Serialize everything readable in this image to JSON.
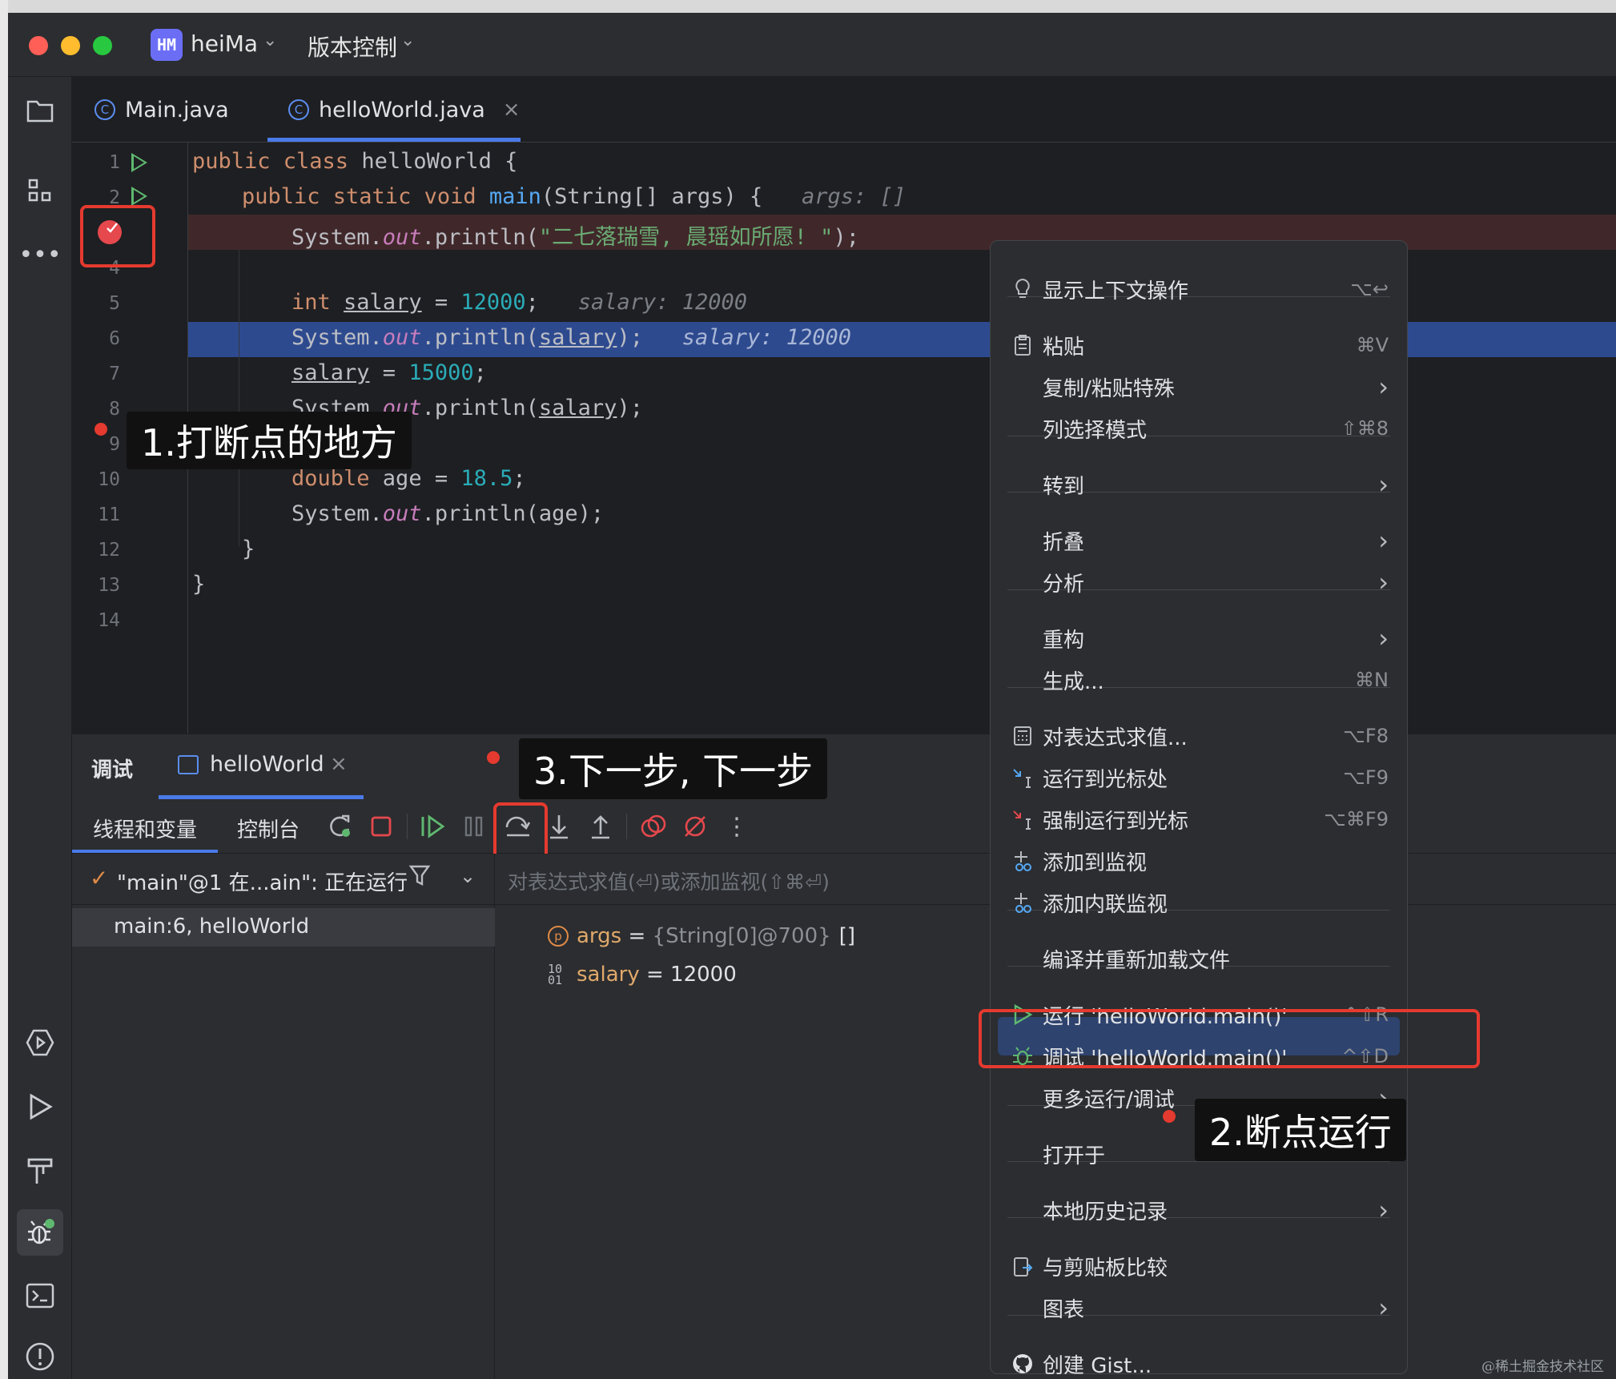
{
  "titlebar": {
    "project_badge": "HM",
    "project_name": "heiMa",
    "vcs_label": "版本控制"
  },
  "tabs": [
    {
      "label": "Main.java",
      "icon": "class-c-icon"
    },
    {
      "label": "helloWorld.java",
      "icon": "class-c-icon",
      "active": true,
      "close": "×"
    }
  ],
  "editor": {
    "line_numbers": [
      "1",
      "2",
      "3",
      "4",
      "5",
      "6",
      "7",
      "8",
      "9",
      "10",
      "11",
      "12",
      "13",
      "14"
    ],
    "lines": {
      "l1": {
        "kw": "public class",
        "rest": " helloWorld {"
      },
      "l2": {
        "kw": "public static void",
        "fn": "main",
        "rest": "(String[] args) {",
        "hint": "args: []"
      },
      "l3": {
        "pre": "System.",
        "field": "out",
        "mid": ".println(",
        "str": "\"二七落瑞雪, 晨瑶如所愿! \"",
        "post": ");"
      },
      "l5": {
        "kw": "int",
        "var": "salary",
        "eq": " = ",
        "num": "12000",
        "post": ";",
        "hint": "salary: 12000"
      },
      "l6": {
        "pre": "System.",
        "field": "out",
        "mid": ".println(",
        "var": "salary",
        "post": ");",
        "hint": "salary: 12000"
      },
      "l7": {
        "var": "salary",
        "eq": " = ",
        "num": "15000",
        "post": ";"
      },
      "l8": {
        "pre": "System.",
        "field": "out",
        "mid": ".println(",
        "var": "salary",
        "post": ");"
      },
      "l10": {
        "kw": "double",
        "rest": " age = ",
        "num": "18.5",
        "post": ";"
      },
      "l11": {
        "pre": "System.",
        "field": "out",
        "mid": ".println(age);"
      },
      "l12": "}",
      "l13": "}"
    }
  },
  "debug": {
    "title": "调试",
    "session_tab": "helloWorld",
    "session_close": "×",
    "threads_tab": "线程和变量",
    "console_tab": "控制台",
    "thread_status": "\"main\"@1 在...ain\": 正在运行",
    "frame": "main:6, helloWorld",
    "eval_placeholder": "对表达式求值(⏎)或添加监视(⇧⌘⏎)",
    "vars": [
      {
        "name": "args",
        "eq": " = ",
        "type": "{String[0]@700}",
        "value": "[]"
      },
      {
        "name": "salary",
        "eq": " = ",
        "value": "12000"
      }
    ],
    "more": "⋮"
  },
  "menu": {
    "items": [
      {
        "label": "显示上下文操作",
        "shortcut": "⌥↩",
        "icon": "bulb-icon"
      },
      {
        "label": "粘贴",
        "shortcut": "⌘V",
        "icon": "clipboard-icon"
      },
      {
        "label": "复制/粘贴特殊",
        "shortcut": "›"
      },
      {
        "label": "列选择模式",
        "shortcut": "⇧⌘8"
      },
      {
        "label": "转到",
        "shortcut": "›"
      },
      {
        "label": "折叠",
        "shortcut": "›"
      },
      {
        "label": "分析",
        "shortcut": "›"
      },
      {
        "label": "重构",
        "shortcut": "›"
      },
      {
        "label": "生成...",
        "shortcut": "⌘N"
      },
      {
        "label": "对表达式求值...",
        "shortcut": "⌥F8",
        "icon": "calculator-icon"
      },
      {
        "label": "运行到光标处",
        "shortcut": "⌥F9",
        "icon": "run-to-cursor-icon"
      },
      {
        "label": "强制运行到光标",
        "shortcut": "⌥⌘F9",
        "icon": "force-run-to-cursor-icon"
      },
      {
        "label": "添加到监视",
        "shortcut": "",
        "icon": "add-watch-icon"
      },
      {
        "label": "添加内联监视",
        "shortcut": "",
        "icon": "add-inline-watch-icon"
      },
      {
        "label": "编译并重新加载文件",
        "shortcut": ""
      },
      {
        "label": "运行 'helloWorld.main()'",
        "shortcut": "^⇧R",
        "icon": "run-icon"
      },
      {
        "label": "调试 'helloWorld.main()'",
        "shortcut": "^⇧D",
        "icon": "bug-icon"
      },
      {
        "label": "更多运行/调试",
        "shortcut": "›"
      },
      {
        "label": "打开于",
        "shortcut": "›"
      },
      {
        "label": "本地历史记录",
        "shortcut": "›"
      },
      {
        "label": "与剪贴板比较",
        "shortcut": "",
        "icon": "compare-clipboard-icon"
      },
      {
        "label": "图表",
        "shortcut": "›"
      },
      {
        "label": "创建 Gist...",
        "shortcut": "",
        "icon": "github-icon"
      }
    ]
  },
  "annotations": {
    "a1": "1.打断点的地方",
    "a2": "2.断点运行",
    "a3": "3.下一步, 下一步"
  },
  "watermark": "@稀土掘金技术社区",
  "colors": {
    "accent": "#4a7ae8",
    "annotation_red": "#e53a2f",
    "breakpoint": "#e5484d",
    "run_green": "#5fb870"
  }
}
